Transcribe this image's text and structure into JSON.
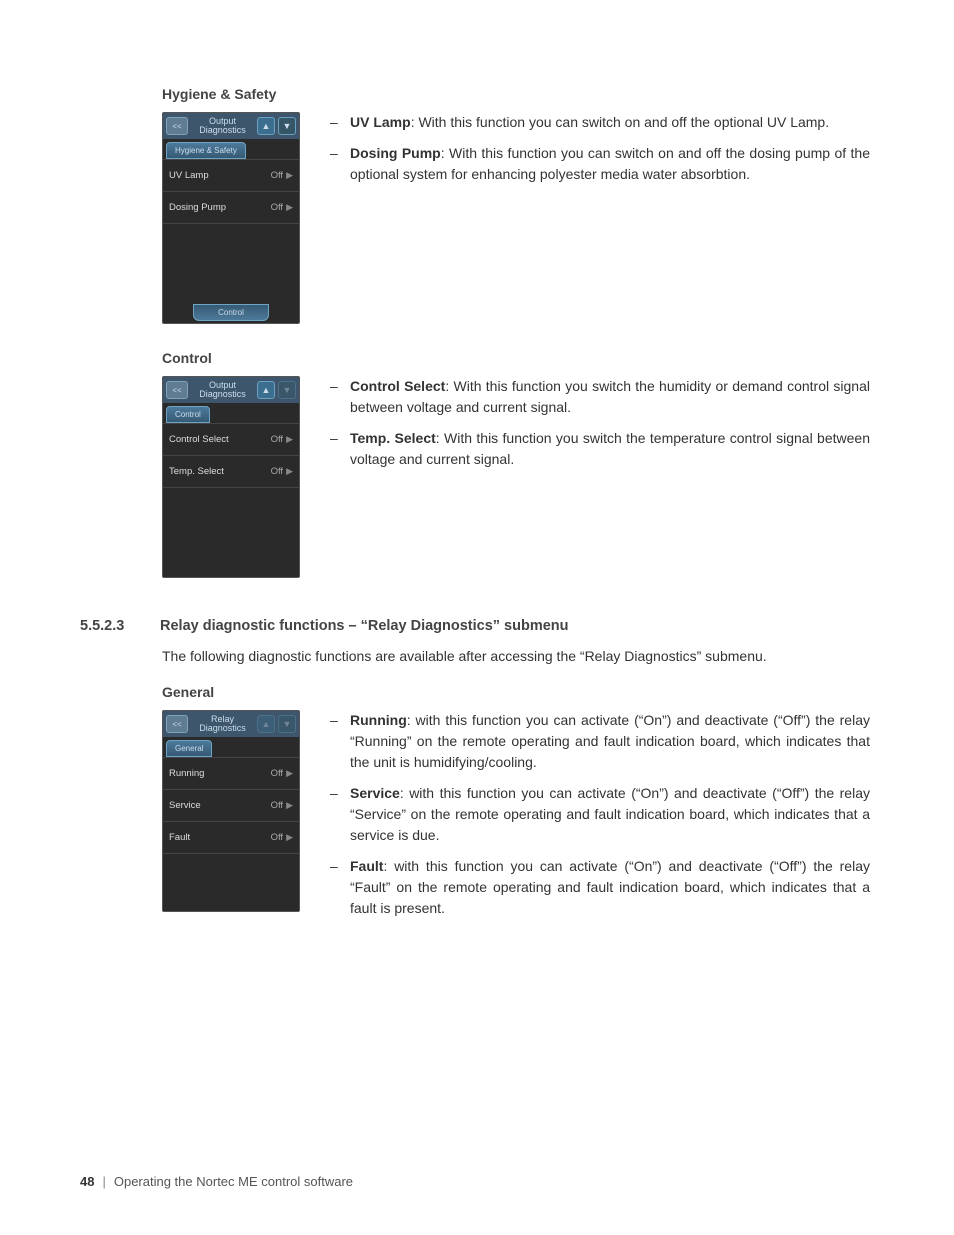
{
  "sections": {
    "hygiene": {
      "title": "Hygiene & Safety",
      "screen": {
        "back": "<<",
        "header_l1": "Output",
        "header_l2": "Diagnostics",
        "tab": "Hygiene & Safety",
        "rows": [
          {
            "label": "UV Lamp",
            "value": "Off"
          },
          {
            "label": "Dosing Pump",
            "value": "Off"
          }
        ],
        "footer": "Control"
      },
      "desc": [
        {
          "bold": "UV Lamp",
          "text": ": With this function you can switch on and off the optional UV Lamp."
        },
        {
          "bold": "Dosing Pump",
          "text": ": With this function you can switch on and off the dosing pump of the optional system for enhancing polyester media water absorbtion."
        }
      ]
    },
    "control": {
      "title": "Control",
      "screen": {
        "back": "<<",
        "header_l1": "Output",
        "header_l2": "Diagnostics",
        "tab": "Control",
        "rows": [
          {
            "label": "Control Select",
            "value": "Off"
          },
          {
            "label": "Temp. Select",
            "value": "Off"
          }
        ]
      },
      "desc": [
        {
          "bold": "Control Select",
          "text": ": With this function you switch the humidity or demand control signal between voltage and current signal."
        },
        {
          "bold": "Temp. Select",
          "text": ": With this function you switch the temperature control signal between voltage and current signal."
        }
      ]
    },
    "relay": {
      "num": "5.5.2.3",
      "heading": "Relay diagnostic functions – “Relay Diagnostics” submenu",
      "intro": "The following diagnostic functions are available after accessing the “Relay Diagnostics” submenu.",
      "general_title": "General",
      "screen": {
        "back": "<<",
        "header_l1": "Relay",
        "header_l2": "Diagnostics",
        "tab": "General",
        "rows": [
          {
            "label": "Running",
            "value": "Off"
          },
          {
            "label": "Service",
            "value": "Off"
          },
          {
            "label": "Fault",
            "value": "Off"
          }
        ]
      },
      "desc": [
        {
          "bold": "Running",
          "text": ": with this function you can activate (“On”) and deactivate (“Off”) the relay “Running” on the remote operating and fault indication board, which indicates that the unit is humidifying/cooling."
        },
        {
          "bold": "Service",
          "text": ": with this function you can activate (“On”) and deactivate (“Off”) the relay “Service” on the remote operating and fault indication board, which indicates that a service is due."
        },
        {
          "bold": "Fault",
          "text": ": with this function you can activate (“On”) and deactivate (“Off”) the relay “Fault” on the remote operating and fault indication board, which indicates that a fault is present."
        }
      ]
    }
  },
  "footer": {
    "page": "48",
    "title": "Operating the Nortec ME control software"
  }
}
